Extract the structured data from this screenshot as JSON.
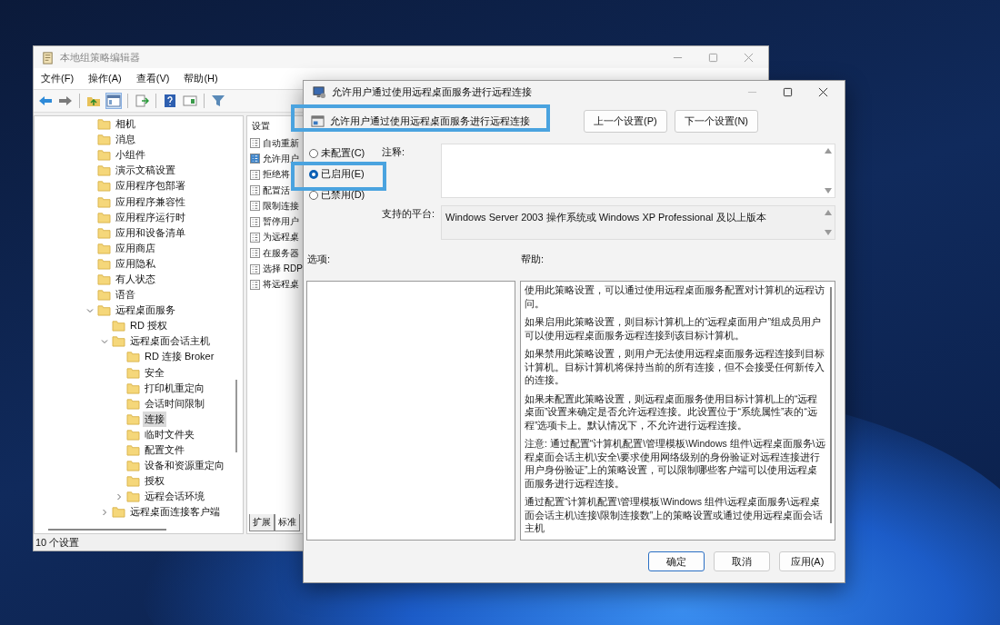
{
  "editor_window": {
    "title": "本地组策略编辑器",
    "menu": [
      "文件(F)",
      "操作(A)",
      "查看(V)",
      "帮助(H)"
    ],
    "tree": {
      "items": [
        {
          "label": "相机",
          "selected": false
        },
        {
          "label": "消息",
          "selected": false
        },
        {
          "label": "小组件",
          "selected": false
        },
        {
          "label": "演示文稿设置",
          "selected": false
        },
        {
          "label": "应用程序包部署",
          "selected": false
        },
        {
          "label": "应用程序兼容性",
          "selected": false
        },
        {
          "label": "应用程序运行时",
          "selected": false
        },
        {
          "label": "应用和设备清单",
          "selected": false
        },
        {
          "label": "应用商店",
          "selected": false
        },
        {
          "label": "应用隐私",
          "selected": false
        },
        {
          "label": "有人状态",
          "selected": false
        },
        {
          "label": "语音",
          "selected": false
        },
        {
          "label": "远程桌面服务",
          "selected": false,
          "expanded": true,
          "children": [
            {
              "label": "RD 授权",
              "selected": false
            },
            {
              "label": "远程桌面会话主机",
              "selected": false,
              "expanded": true,
              "children": [
                {
                  "label": "RD 连接 Broker",
                  "selected": false
                },
                {
                  "label": "安全",
                  "selected": false
                },
                {
                  "label": "打印机重定向",
                  "selected": false
                },
                {
                  "label": "会话时间限制",
                  "selected": false
                },
                {
                  "label": "连接",
                  "selected": true
                },
                {
                  "label": "临时文件夹",
                  "selected": false
                },
                {
                  "label": "配置文件",
                  "selected": false
                },
                {
                  "label": "设备和资源重定向",
                  "selected": false
                },
                {
                  "label": "授权",
                  "selected": false
                },
                {
                  "label": "远程会话环境",
                  "selected": false,
                  "expanded": false
                }
              ]
            },
            {
              "label": "远程桌面连接客户端",
              "selected": false,
              "expanded": false
            }
          ]
        }
      ]
    },
    "settings_list": {
      "header": "设置",
      "items": [
        {
          "label": "自动重新",
          "selected": false
        },
        {
          "label": "允许用户",
          "selected": true
        },
        {
          "label": "拒绝将",
          "selected": false
        },
        {
          "label": "配置活",
          "selected": false
        },
        {
          "label": "限制连接",
          "selected": false
        },
        {
          "label": "暂停用户",
          "selected": false
        },
        {
          "label": "为远程桌",
          "selected": false
        },
        {
          "label": "在服务器",
          "selected": false
        },
        {
          "label": "选择 RDP",
          "selected": false
        },
        {
          "label": "将远程桌",
          "selected": false
        }
      ]
    },
    "view_tabs": [
      {
        "label": "扩展",
        "selected": false
      },
      {
        "label": "标准",
        "selected": true
      }
    ],
    "status_bar": "10 个设置"
  },
  "dialog": {
    "title": "允许用户通过使用远程桌面服务进行远程连接",
    "heading": "允许用户通过使用远程桌面服务进行远程连接",
    "nav_buttons": [
      "上一个设置(P)",
      "下一个设置(N)"
    ],
    "options": [
      {
        "label": "未配置(C)",
        "selected": false
      },
      {
        "label": "已启用(E)",
        "selected": true
      },
      {
        "label": "已禁用(D)",
        "selected": false
      }
    ],
    "comment_label": "注释:",
    "platform_label": "支持的平台:",
    "platform_value": "Windows Server 2003 操作系统或 Windows XP Professional 及以上版本",
    "options_label": "选项:",
    "help_label": "帮助:",
    "help_paragraphs": [
      "使用此策略设置，可以通过使用远程桌面服务配置对计算机的远程访问。",
      "如果启用此策略设置，则目标计算机上的“远程桌面用户”组成员用户可以使用远程桌面服务远程连接到该目标计算机。",
      "如果禁用此策略设置，则用户无法使用远程桌面服务远程连接到目标计算机。目标计算机将保持当前的所有连接，但不会接受任何新传入的连接。",
      "如果未配置此策略设置，则远程桌面服务使用目标计算机上的“远程桌面”设置来确定是否允许远程连接。此设置位于“系统属性”表的“远程”选项卡上。默认情况下，不允许进行远程连接。",
      "注意: 通过配置“计算机配置\\管理模板\\Windows 组件\\远程桌面服务\\远程桌面会话主机\\安全\\要求使用网络级别的身份验证对远程连接进行用户身份验证”上的策略设置，可以限制哪些客户端可以使用远程桌面服务进行远程连接。",
      "通过配置“计算机配置\\管理模板\\Windows 组件\\远程桌面服务\\远程桌面会话主机\\连接\\限制连接数”上的策略设置或通过使用远程桌面会话主机"
    ],
    "buttons": [
      {
        "label": "确定",
        "default": true
      },
      {
        "label": "取消",
        "default": false
      },
      {
        "label": "应用(A)",
        "default": false
      }
    ]
  }
}
